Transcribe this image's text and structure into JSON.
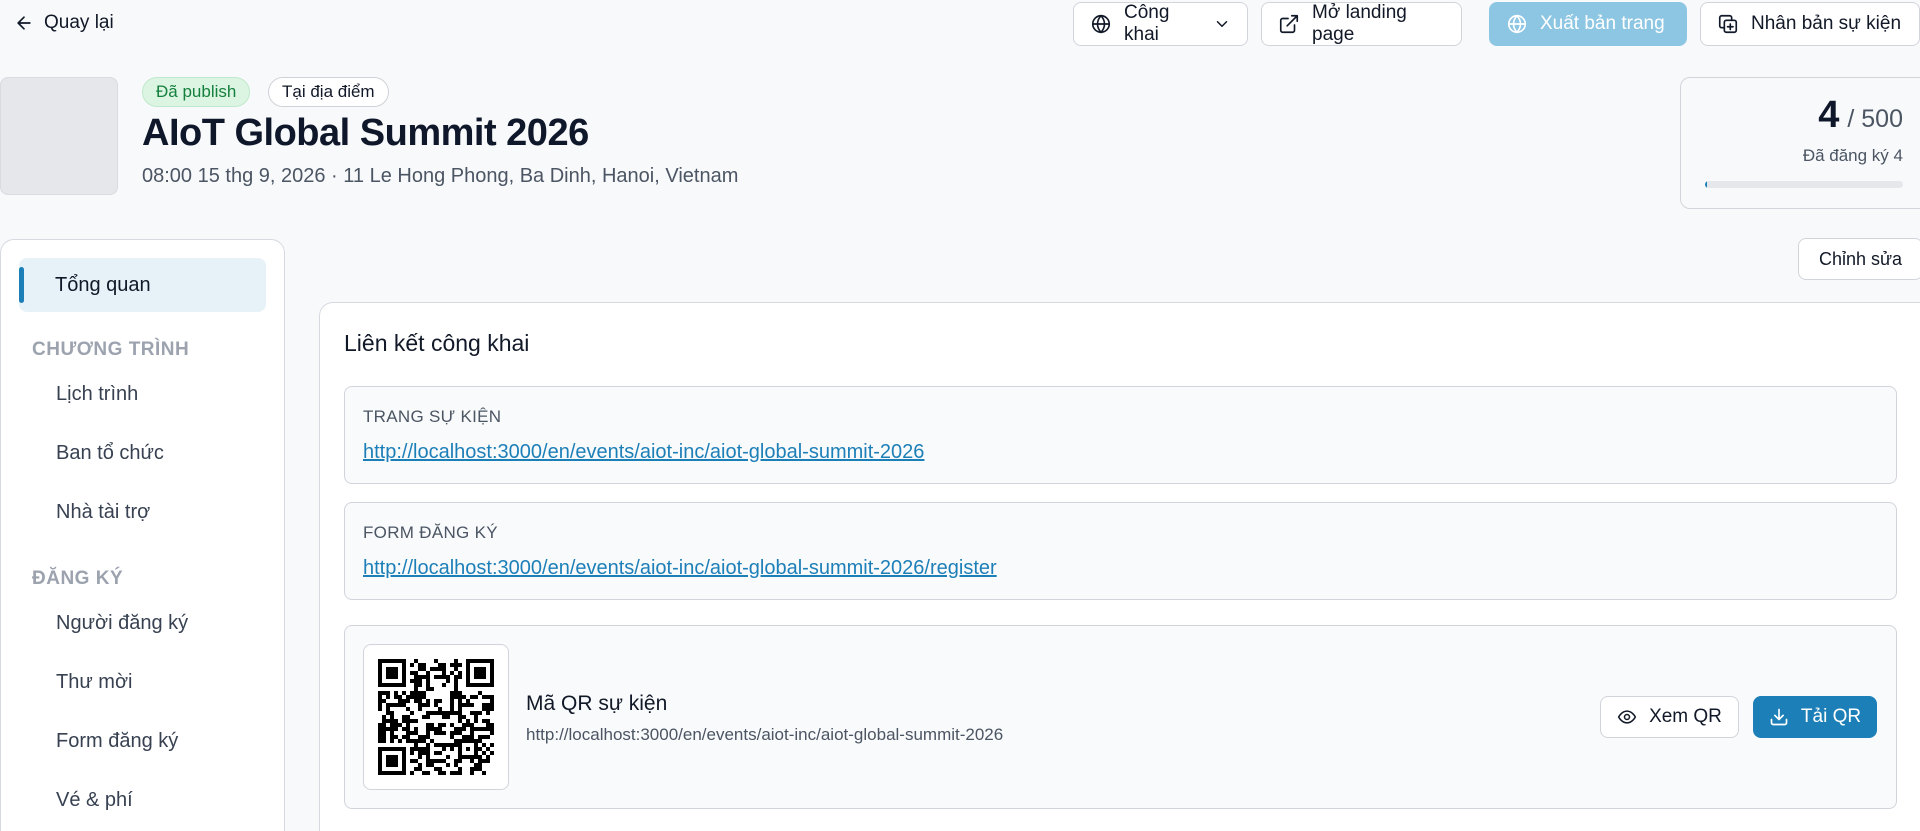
{
  "topbar": {
    "back_label": "Quay lại",
    "visibility_label": "Công khai",
    "landing_label": "Mở landing page",
    "export_label": "Xuất bản trang",
    "clone_label": "Nhân bản sự kiện"
  },
  "event": {
    "badge_status": "Đã publish",
    "badge_mode": "Tại địa điểm",
    "title": "AIoT Global Summit 2026",
    "subtitle": "08:00 15 thg 9, 2026 · 11 Le Hong Phong, Ba Dinh, Hanoi, Vietnam"
  },
  "stats": {
    "registered": "4",
    "capacity": "/ 500",
    "label": "Đã đăng ký 4",
    "progress_percent": 0.8
  },
  "sidebar": {
    "active": "Tổng quan",
    "section_program": "CHƯƠNG TRÌNH",
    "program_items": [
      "Lịch trình",
      "Ban tổ chức",
      "Nhà tài trợ"
    ],
    "section_register": "ĐĂNG KÝ",
    "register_items": [
      "Người đăng ký",
      "Thư mời",
      "Form đăng ký",
      "Vé & phí"
    ]
  },
  "main": {
    "edit_label": "Chỉnh sửa",
    "card_title": "Liên kết công khai",
    "event_page_label": "TRANG SỰ KIỆN",
    "event_page_url": "http://localhost:3000/en/events/aiot-inc/aiot-global-summit-2026",
    "register_form_label": "FORM ĐĂNG KÝ",
    "register_form_url": "http://localhost:3000/en/events/aiot-inc/aiot-global-summit-2026/register",
    "qr_title": "Mã QR sự kiện",
    "qr_url": "http://localhost:3000/en/events/aiot-inc/aiot-global-summit-2026",
    "qr_view_label": "Xem QR",
    "qr_download_label": "Tải QR"
  },
  "colors": {
    "accent": "#1d7fb8",
    "accent_light": "#8dc6e3",
    "published_green": "#15803d"
  },
  "icons": {
    "back": "arrow-left-icon",
    "visibility": "globe-icon",
    "dropdown": "chevron-down-icon",
    "landing": "external-link-icon",
    "export": "globe-icon",
    "clone": "copy-icon",
    "view": "eye-icon",
    "download": "download-icon"
  }
}
